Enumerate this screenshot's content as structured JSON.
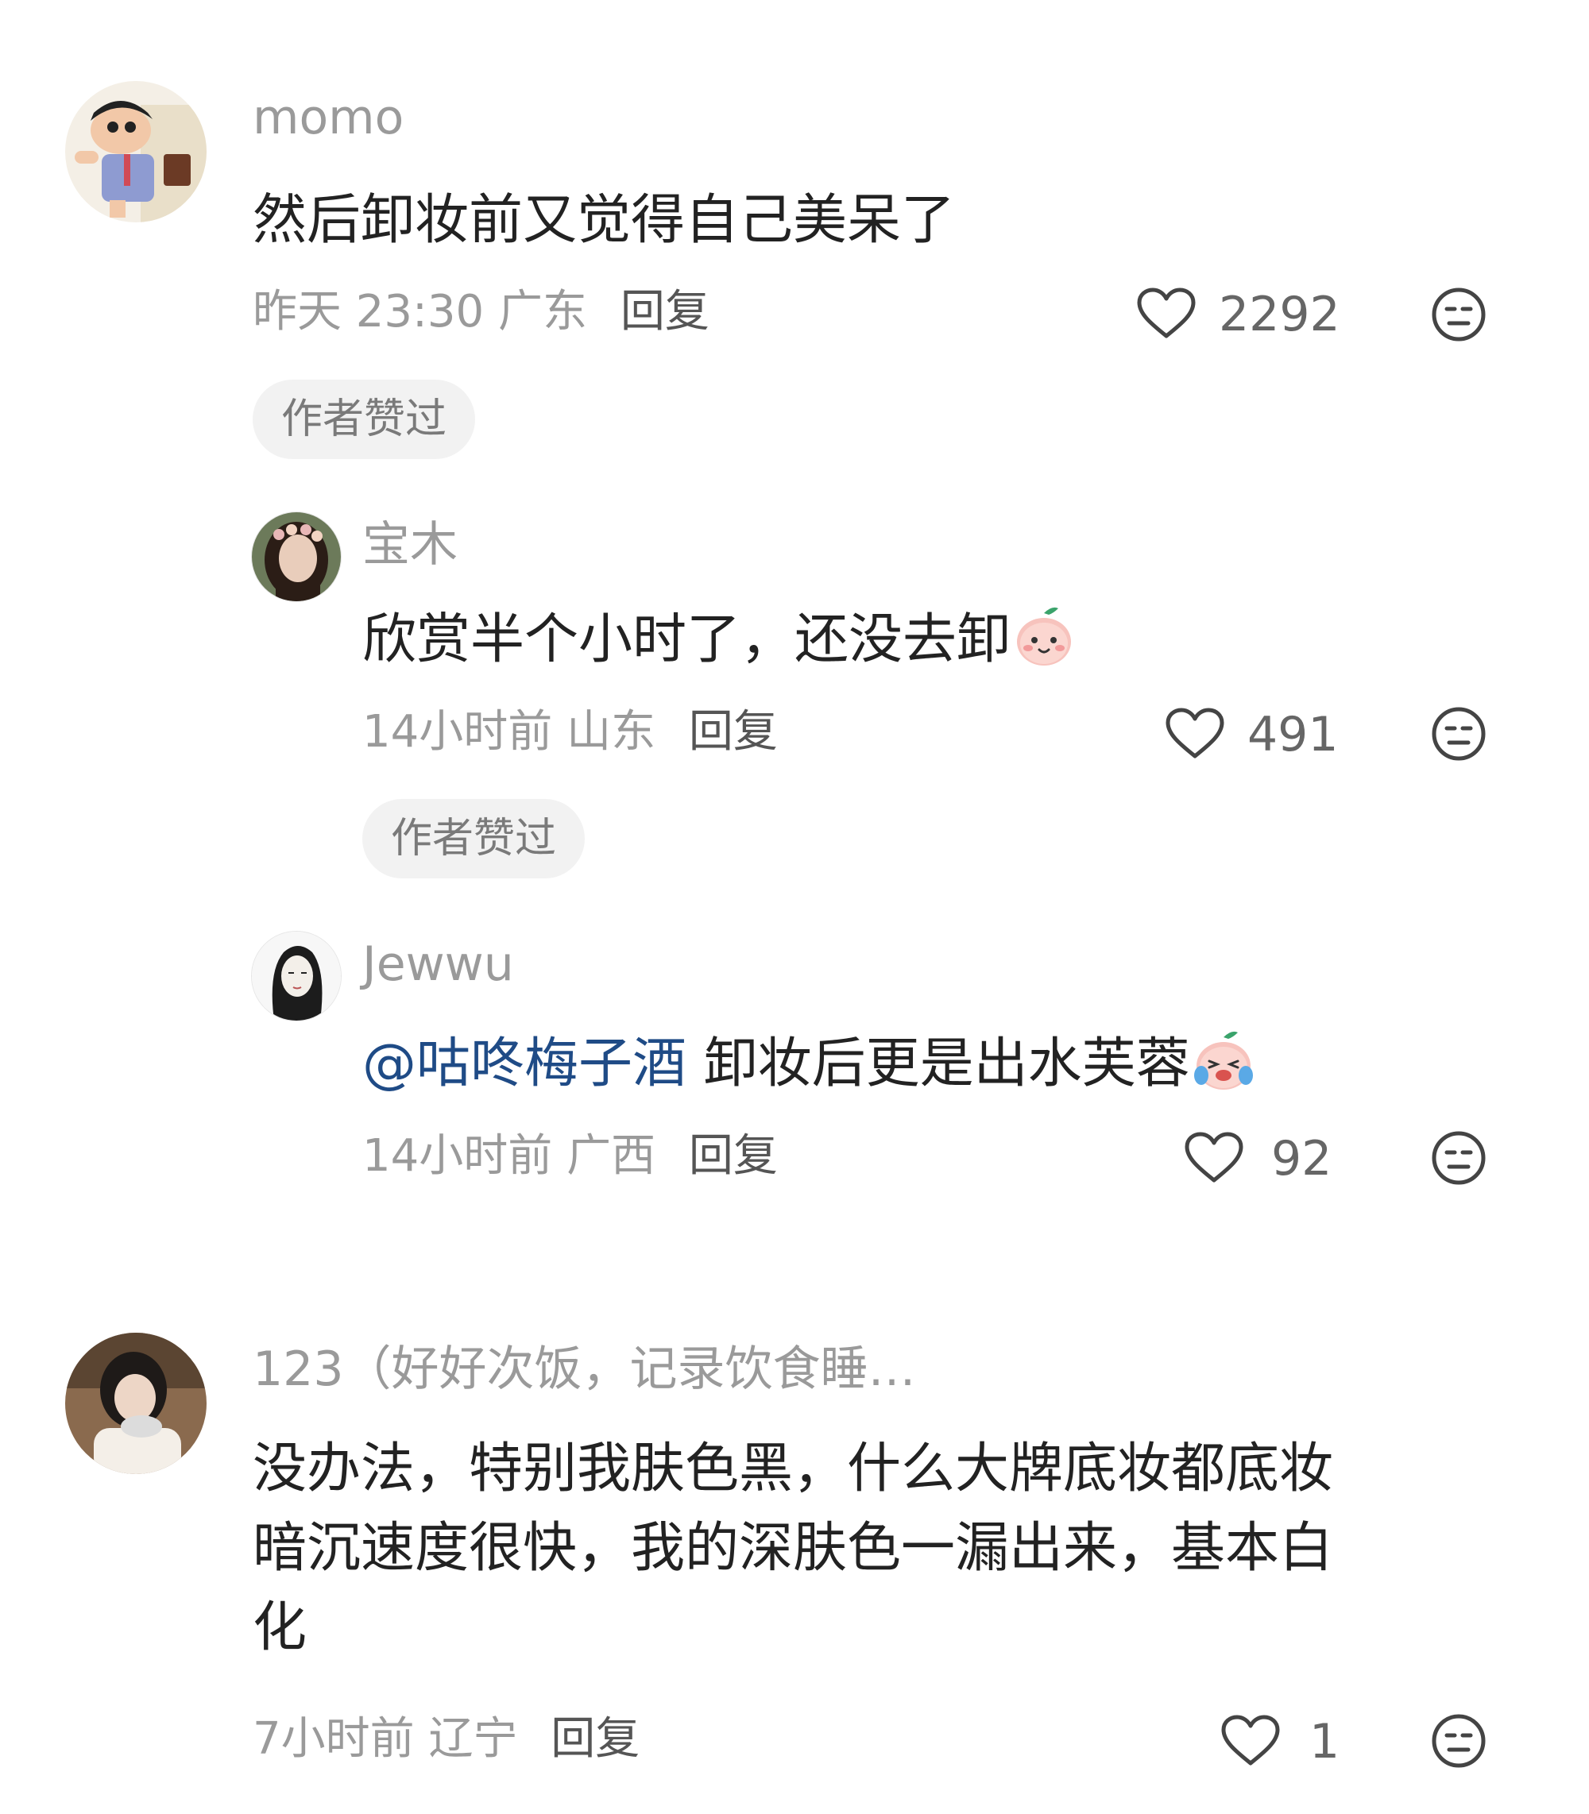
{
  "comments": [
    {
      "username": "momo",
      "content": "然后卸妆前又觉得自己美呆了",
      "time": "昨天 23:30",
      "location": "广东",
      "reply_label": "回复",
      "likes": "2292",
      "badge": "作者赞过",
      "avatar_icon": "cartoon-avatar",
      "replies": [
        {
          "username": "宝木",
          "content": "欣赏半个小时了，还没去卸",
          "emoji": "smile-peach-emoji",
          "time": "14小时前",
          "location": "山东",
          "reply_label": "回复",
          "likes": "491",
          "badge": "作者赞过"
        },
        {
          "username": "Jewwu",
          "mention": "@咕咚梅子酒",
          "content": "卸妆后更是出水芙蓉",
          "emoji": "crying-peach-emoji",
          "time": "14小时前",
          "location": "广西",
          "reply_label": "回复",
          "likes": "92"
        }
      ]
    },
    {
      "username": "123（好好次饭，记录饮食睡…",
      "content_lines": [
        "没办法，特别我肤色黑，什么大牌底妆都底妆",
        "暗沉速度很快，我的深肤色一漏出来，基本白",
        "化"
      ],
      "time": "7小时前",
      "location": "辽宁",
      "reply_label": "回复",
      "likes": "1"
    }
  ],
  "colors": {
    "text": "#222222",
    "secondary": "#9a9a9a",
    "mention": "#1f4b86",
    "badge_bg": "#f2f2f2"
  }
}
